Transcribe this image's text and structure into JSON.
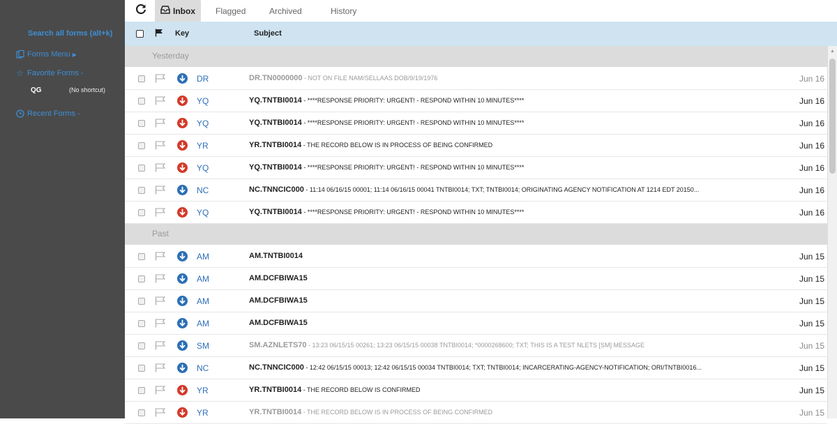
{
  "sidebar": {
    "search_label": "Search all forms (alt+k)",
    "forms_menu": "Forms Menu",
    "favorite_forms": "Favorite Forms",
    "favorite_caret": "-",
    "favorite_item_key": "QG",
    "favorite_item_shortcut": "(No shortcut)",
    "recent_forms": "Recent Forms",
    "recent_caret": "-"
  },
  "tabs": {
    "inbox": "Inbox",
    "flagged": "Flagged",
    "archived": "Archived",
    "history": "History"
  },
  "table_header": {
    "key": "Key",
    "subject": "Subject"
  },
  "groups": [
    {
      "label": "Yesterday",
      "rows": [
        {
          "read": true,
          "dir": "blue",
          "key": "DR",
          "subject_bold": "DR.TN0000000",
          "subject_rest": " - NOT ON FILE NAM/SELLAAS.DOB/9/19/1976",
          "date": "Jun 16"
        },
        {
          "read": false,
          "dir": "red",
          "key": "YQ",
          "subject_bold": "YQ.TNTBI0014",
          "subject_rest": " - ****RESPONSE PRIORITY: URGENT! - RESPOND WITHIN 10 MINUTES****",
          "date": "Jun 16"
        },
        {
          "read": false,
          "dir": "red",
          "key": "YQ",
          "subject_bold": "YQ.TNTBI0014",
          "subject_rest": " - ****RESPONSE PRIORITY: URGENT! - RESPOND WITHIN 10 MINUTES****",
          "date": "Jun 16"
        },
        {
          "read": false,
          "dir": "red",
          "key": "YR",
          "subject_bold": "YR.TNTBI0014",
          "subject_rest": " - THE RECORD BELOW IS IN PROCESS OF BEING CONFIRMED",
          "date": "Jun 16"
        },
        {
          "read": false,
          "dir": "red",
          "key": "YQ",
          "subject_bold": "YQ.TNTBI0014",
          "subject_rest": " - ****RESPONSE PRIORITY: URGENT! - RESPOND WITHIN 10 MINUTES****",
          "date": "Jun 16"
        },
        {
          "read": false,
          "dir": "blue",
          "key": "NC",
          "subject_bold": "NC.TNNCIC000",
          "subject_rest": " - 11:14 06/16/15 00001; 11:14 06/16/15 00041 TNTBI0014; TXT; TNTBI0014; ORIGINATING AGENCY NOTIFICATION AT 1214 EDT 20150...",
          "date": "Jun 16"
        },
        {
          "read": false,
          "dir": "red",
          "key": "YQ",
          "subject_bold": "YQ.TNTBI0014",
          "subject_rest": " - ****RESPONSE PRIORITY: URGENT! - RESPOND WITHIN 10 MINUTES****",
          "date": "Jun 16"
        }
      ]
    },
    {
      "label": "Past",
      "rows": [
        {
          "read": false,
          "dir": "blue",
          "key": "AM",
          "subject_bold": "AM.TNTBI0014",
          "subject_rest": "",
          "date": "Jun 15"
        },
        {
          "read": false,
          "dir": "blue",
          "key": "AM",
          "subject_bold": "AM.DCFBIWA15",
          "subject_rest": "",
          "date": "Jun 15"
        },
        {
          "read": false,
          "dir": "blue",
          "key": "AM",
          "subject_bold": "AM.DCFBIWA15",
          "subject_rest": "",
          "date": "Jun 15"
        },
        {
          "read": false,
          "dir": "blue",
          "key": "AM",
          "subject_bold": "AM.DCFBIWA15",
          "subject_rest": "",
          "date": "Jun 15"
        },
        {
          "read": true,
          "dir": "blue",
          "key": "SM",
          "subject_bold": "SM.AZNLETS70",
          "subject_rest": " - 13:23 06/15/15 00261; 13:23 06/15/15 00038 TNTBI0014; *0000268600; TXT; THIS IS A TEST NLETS [SM] MESSAGE",
          "date": "Jun 15"
        },
        {
          "read": false,
          "dir": "blue",
          "key": "NC",
          "subject_bold": "NC.TNNCIC000",
          "subject_rest": " - 12:42 06/15/15 00013; 12:42 06/15/15 00034 TNTBI0014; TXT; TNTBI0014; INCARCERATING-AGENCY-NOTIFICATION; ORI/TNTBI0016...",
          "date": "Jun 15"
        },
        {
          "read": false,
          "dir": "red",
          "key": "YR",
          "subject_bold": "YR.TNTBI0014",
          "subject_rest": " - THE RECORD BELOW IS CONFIRMED",
          "date": "Jun 15"
        },
        {
          "read": true,
          "dir": "red",
          "key": "YR",
          "subject_bold": "YR.TNTBI0014",
          "subject_rest": " - THE RECORD BELOW IS IN PROCESS OF BEING CONFIRMED",
          "date": "Jun 15"
        }
      ]
    }
  ]
}
